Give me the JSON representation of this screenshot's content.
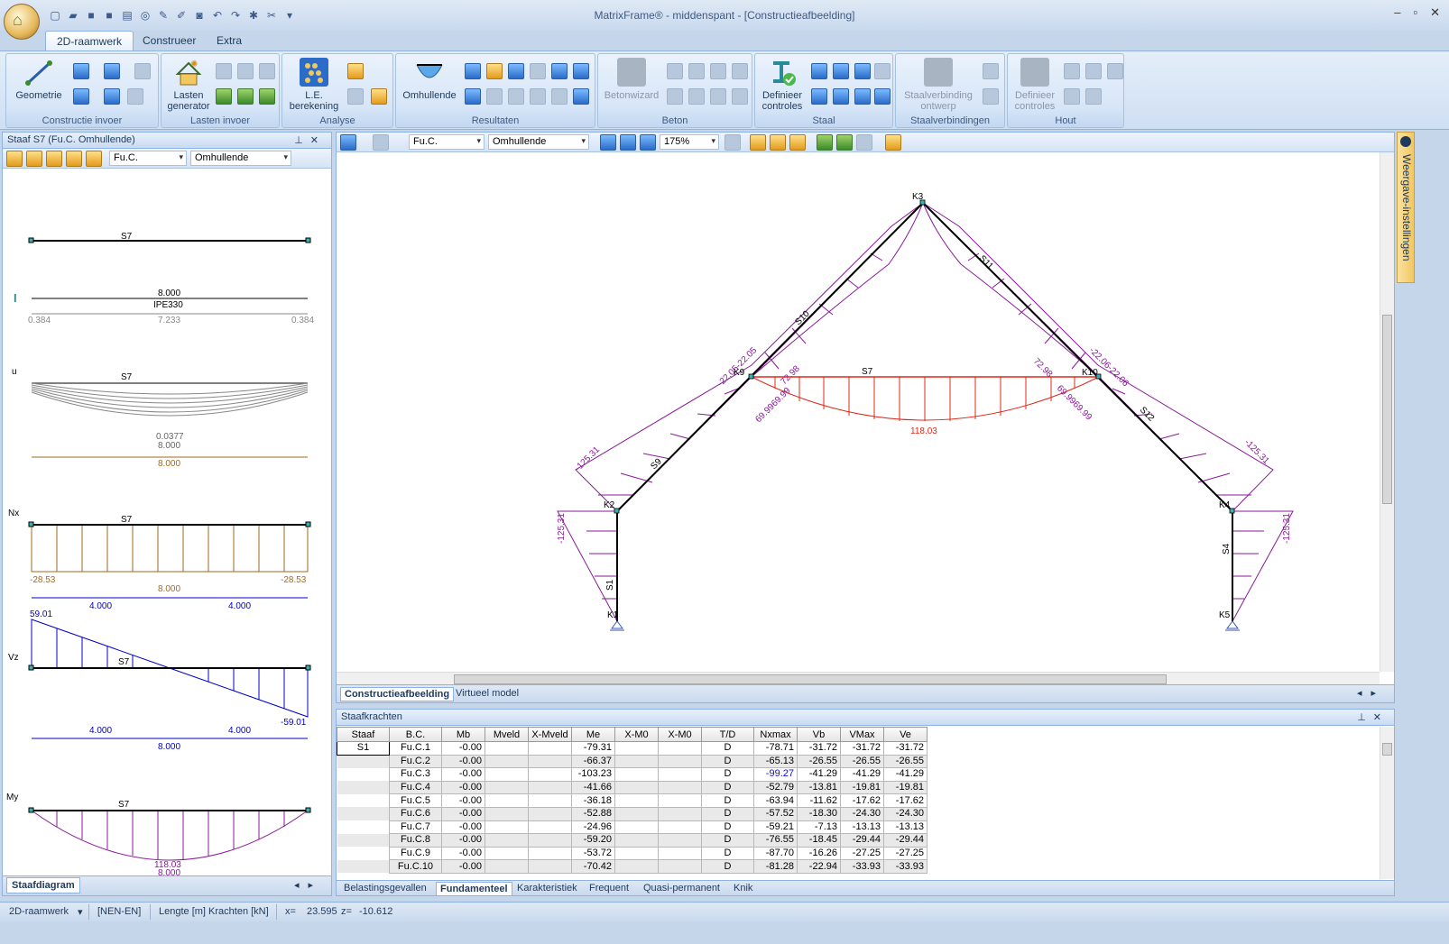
{
  "window": {
    "title": "MatrixFrame® - middenspant - [Constructieafbeelding]"
  },
  "ribbon": {
    "tabs": [
      "2D-raamwerk",
      "Construeer",
      "Extra"
    ],
    "groups": [
      {
        "label": "Constructie invoer",
        "big": [
          "Geometrie"
        ]
      },
      {
        "label": "Lasten invoer",
        "big": [
          "Lasten generator"
        ]
      },
      {
        "label": "Analyse",
        "big": [
          "L.E. berekening"
        ]
      },
      {
        "label": "Resultaten",
        "big": [
          "Omhullende"
        ]
      },
      {
        "label": "Beton",
        "big": [
          "Betonwizard"
        ]
      },
      {
        "label": "Staal",
        "big": [
          "Definieer controles"
        ]
      },
      {
        "label": "Staalverbindingen",
        "big": [
          "Staalverbinding ontwerp"
        ]
      },
      {
        "label": "Hout",
        "big": [
          "Definieer controles"
        ]
      }
    ]
  },
  "left_panel": {
    "title": "Staaf S7 (Fu.C. Omhullende)",
    "combo1": "Fu.C.",
    "combo2": "Omhullende",
    "tab": "Staafdiagram",
    "labels": {
      "member": "S7",
      "length": "8.000",
      "profile": "IPE330",
      "sec_left": "0.384",
      "sec_mid": "7.233",
      "sec_right": "0.384",
      "u_label": "u",
      "u_val": "0.0377",
      "nx_label": "Nx",
      "nx_left": "-28.53",
      "nx_right": "-28.53",
      "half": "4.000",
      "vz_label": "Vz",
      "vz_top": "59.01",
      "vz_bottom": "-59.01",
      "my_label": "My",
      "my_val": "118.03"
    }
  },
  "main": {
    "combo1": "Fu.C.",
    "combo2": "Omhullende",
    "zoom": "175%",
    "tabs": [
      "Constructieafbeelding",
      "Virtueel model"
    ],
    "labels": {
      "nodes": [
        "K1",
        "K2",
        "K3",
        "K4",
        "K5",
        "K9",
        "K10"
      ],
      "members": [
        "S1",
        "S4",
        "S7",
        "S9",
        "S10",
        "S11",
        "S12"
      ],
      "v_left": "-125.31",
      "v_right": "-125.31",
      "r_left_bot": "-125.31",
      "r_right_bot": "-125.31",
      "r_left_top": "-22.05-22.05",
      "r_right_top": "-22.06-22.06",
      "r_left_in": "72.98",
      "r_right_in": "72.98",
      "r_left_in2": "69.9969.99",
      "r_right_in2": "69.9969.99",
      "s7_val": "118.03"
    }
  },
  "right_strip": {
    "label": "Weergave-instellingen"
  },
  "table": {
    "title": "Staafkrachten",
    "columns": [
      "Staaf",
      "B.C.",
      "Mb",
      "Mveld",
      "X-Mveld",
      "Me",
      "X-M0",
      "X-M0",
      "T/D",
      "Nxmax",
      "Vb",
      "VMax",
      "Ve"
    ],
    "rows": [
      [
        "S1",
        "Fu.C.1",
        "-0.00",
        "",
        "",
        "-79.31",
        "",
        "",
        "D",
        "-78.71",
        "-31.72",
        "-31.72",
        "-31.72"
      ],
      [
        "",
        "Fu.C.2",
        "-0.00",
        "",
        "",
        "-66.37",
        "",
        "",
        "D",
        "-65.13",
        "-26.55",
        "-26.55",
        "-26.55"
      ],
      [
        "",
        "Fu.C.3",
        "-0.00",
        "",
        "",
        "-103.23",
        "",
        "",
        "D",
        "-99.27",
        "-41.29",
        "-41.29",
        "-41.29"
      ],
      [
        "",
        "Fu.C.4",
        "-0.00",
        "",
        "",
        "-41.66",
        "",
        "",
        "D",
        "-52.79",
        "-13.81",
        "-19.81",
        "-19.81"
      ],
      [
        "",
        "Fu.C.5",
        "-0.00",
        "",
        "",
        "-36.18",
        "",
        "",
        "D",
        "-63.94",
        "-11.62",
        "-17.62",
        "-17.62"
      ],
      [
        "",
        "Fu.C.6",
        "-0.00",
        "",
        "",
        "-52.88",
        "",
        "",
        "D",
        "-57.52",
        "-18.30",
        "-24.30",
        "-24.30"
      ],
      [
        "",
        "Fu.C.7",
        "-0.00",
        "",
        "",
        "-24.96",
        "",
        "",
        "D",
        "-59.21",
        "-7.13",
        "-13.13",
        "-13.13"
      ],
      [
        "",
        "Fu.C.8",
        "-0.00",
        "",
        "",
        "-59.20",
        "",
        "",
        "D",
        "-76.55",
        "-18.45",
        "-29.44",
        "-29.44"
      ],
      [
        "",
        "Fu.C.9",
        "-0.00",
        "",
        "",
        "-53.72",
        "",
        "",
        "D",
        "-87.70",
        "-16.26",
        "-27.25",
        "-27.25"
      ],
      [
        "",
        "Fu.C.10",
        "-0.00",
        "",
        "",
        "-70.42",
        "",
        "",
        "D",
        "-81.28",
        "-22.94",
        "-33.93",
        "-33.93"
      ]
    ],
    "tabs": [
      "Belastingsgevallen",
      "Fundamenteel",
      "Karakteristiek",
      "Frequent",
      "Quasi-permanent",
      "Knik"
    ]
  },
  "status": {
    "mode": "2D-raamwerk",
    "norm": "[NEN-EN]",
    "units": "Lengte [m] Krachten [kN]",
    "coord_x_label": "x=",
    "coord_x": "23.595",
    "coord_z_label": "z=",
    "coord_z": "-10.612"
  }
}
